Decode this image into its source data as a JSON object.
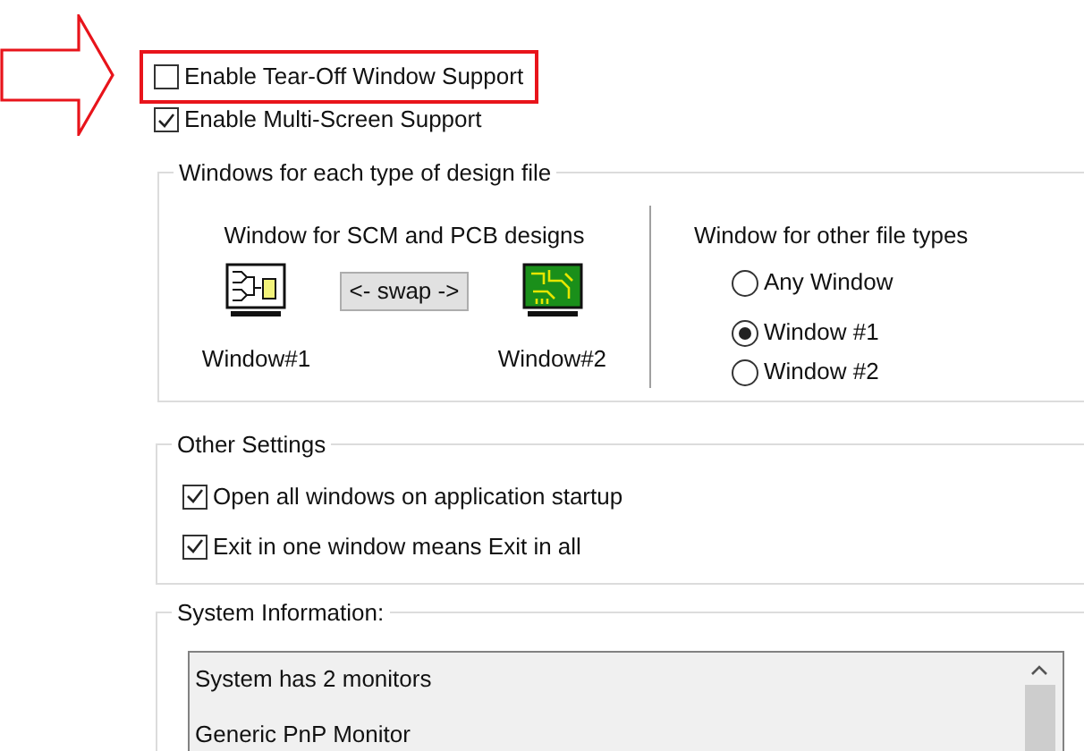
{
  "options": [
    {
      "label": "Enable Tear-Off Window Support",
      "checked": false,
      "highlighted": true
    },
    {
      "label": "Enable Multi-Screen Support",
      "checked": true,
      "highlighted": false
    }
  ],
  "windows_group": {
    "title": "Windows for each type of design file",
    "left": {
      "heading": "Window for SCM and PCB designs",
      "window_1": "Window#1",
      "swap_button": "<- swap ->",
      "window_2": "Window#2"
    },
    "right": {
      "heading": "Window for other file types",
      "radios": [
        {
          "label": "Any Window",
          "selected": false
        },
        {
          "label": "Window #1",
          "selected": true
        },
        {
          "label": "Window #2",
          "selected": false
        }
      ]
    }
  },
  "other_settings": {
    "title": "Other Settings",
    "checkboxes": [
      {
        "label": "Open all windows on application startup",
        "checked": true
      },
      {
        "label": "Exit in one window means Exit in all",
        "checked": true
      }
    ]
  },
  "system_information": {
    "title": "System Information:",
    "lines": [
      "System has 2 monitors",
      "Generic PnP Monitor"
    ]
  }
}
